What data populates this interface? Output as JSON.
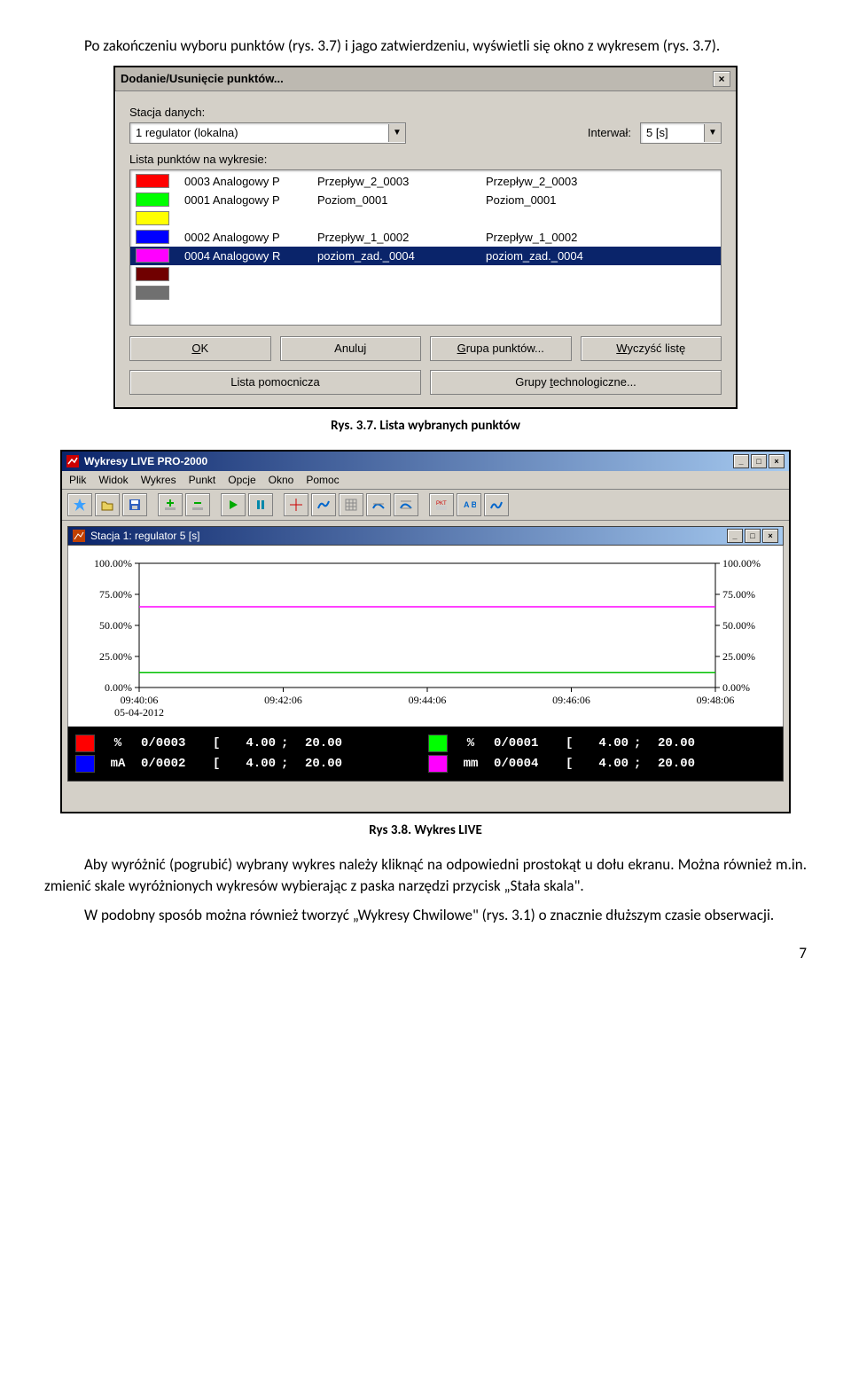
{
  "para_top": "Po zakończeniu wyboru punktów (rys. 3.7) i jago zatwierdzeniu, wyświetli się okno z wykresem (rys. 3.7).",
  "caption1": "Rys. 3.7. Lista wybranych punktów",
  "caption2": "Rys 3.8. Wykres LIVE",
  "para_b1": "Aby wyróżnić (pogrubić) wybrany wykres należy kliknąć na odpowiedni prostokąt u dołu ekranu. Można również m.in. zmienić skale wyróżnionych wykresów wybierając z paska narzędzi przycisk „Stała skala\".",
  "para_b2": "W podobny sposób można również tworzyć „Wykresy Chwilowe\" (rys. 3.1) o znacznie dłuższym czasie obserwacji.",
  "page_number": "7",
  "dialog": {
    "title": "Dodanie/Usunięcie punktów...",
    "close": "×",
    "label_station": "Stacja danych:",
    "station_value": "1 regulator  (lokalna)",
    "label_interval": "Interwał:",
    "interval_value": "5 [s]",
    "label_list": "Lista punktów na wykresie:",
    "rows": [
      {
        "color": "#ff0000",
        "c1": "0003",
        "c2": "Analogowy P",
        "c3": "Przepływ_2_0003",
        "c4": "Przepływ_2_0003",
        "sel": false
      },
      {
        "color": "#00ff00",
        "c1": "0001",
        "c2": "Analogowy P",
        "c3": "Poziom_0001",
        "c4": "Poziom_0001",
        "sel": false
      },
      {
        "color": "#ffff00",
        "c1": "",
        "c2": "",
        "c3": "",
        "c4": "",
        "sel": false
      },
      {
        "color": "#0000ff",
        "c1": "0002",
        "c2": "Analogowy P",
        "c3": "Przepływ_1_0002",
        "c4": "Przepływ_1_0002",
        "sel": false
      },
      {
        "color": "#ff00ff",
        "c1": "0004",
        "c2": "Analogowy R",
        "c3": "poziom_zad._0004",
        "c4": "poziom_zad._0004",
        "sel": true
      },
      {
        "color": "#700000",
        "c1": "",
        "c2": "",
        "c3": "",
        "c4": "",
        "sel": false
      },
      {
        "color": "#707070",
        "c1": "",
        "c2": "",
        "c3": "",
        "c4": "",
        "sel": false
      }
    ],
    "btn_ok": "OK",
    "btn_cancel": "Anuluj",
    "btn_group": "Grupa punktów...",
    "btn_clear": "Wyczyść listę",
    "btn_aux": "Lista pomocnicza",
    "btn_tech": "Grupy technologiczne..."
  },
  "live": {
    "app_title": "Wykresy LIVE PRO-2000",
    "menu": [
      "Plik",
      "Widok",
      "Wykres",
      "Punkt",
      "Opcje",
      "Okno",
      "Pomoc"
    ],
    "inner_title": "Stacja 1: regulator 5 [s]",
    "chart_data": {
      "type": "line",
      "ylim": [
        0,
        100
      ],
      "ylabels": [
        "100.00%",
        "75.00%",
        "50.00%",
        "25.00%",
        "0.00%"
      ],
      "xticks": [
        "09:40:06",
        "09:42:06",
        "09:44:06",
        "09:46:06",
        "09:48:06"
      ],
      "xdate": "05-04-2012",
      "series": [
        {
          "name": "magenta",
          "color": "#ff00ff",
          "y": 65
        },
        {
          "name": "green",
          "color": "#00c000",
          "y": 12
        }
      ]
    },
    "legend": [
      {
        "color": "#ff0000",
        "unit": "%",
        "id": "0/0003",
        "br": "[",
        "v1": "4.00",
        "sc": ";",
        "v2": "20.00"
      },
      {
        "color": "#00ff00",
        "unit": "%",
        "id": "0/0001",
        "br": "[",
        "v1": "4.00",
        "sc": ";",
        "v2": "20.00"
      },
      {
        "color": "#0000ff",
        "unit": "mA",
        "id": "0/0002",
        "br": "[",
        "v1": "4.00",
        "sc": ";",
        "v2": "20.00"
      },
      {
        "color": "#ff00ff",
        "unit": "mm",
        "id": "0/0004",
        "br": "[",
        "v1": "4.00",
        "sc": ";",
        "v2": "20.00"
      }
    ]
  }
}
